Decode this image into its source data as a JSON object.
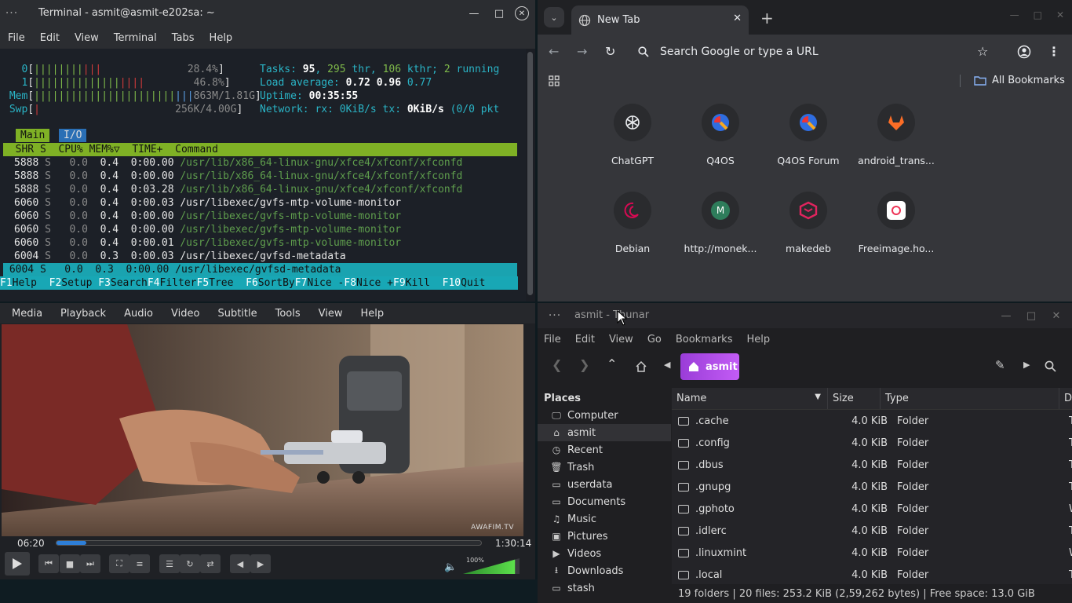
{
  "terminal": {
    "title": "Terminal - asmit@asmit-e202sa: ~",
    "menu": [
      "File",
      "Edit",
      "View",
      "Terminal",
      "Tabs",
      "Help"
    ],
    "cpu0": {
      "bars": "||||||||",
      "pct": "28.4%"
    },
    "cpu1": {
      "bars": "||||||||||||||",
      "pct": "46.8%"
    },
    "mem": {
      "bars": "|||||||||||||||||||||||",
      "value": "863M/1.81G"
    },
    "swp": {
      "value": "256K/4.00G"
    },
    "tasks": {
      "label": "Tasks: ",
      "tasks": "95",
      "thr": "295",
      "kthr": "106",
      "running": "2"
    },
    "load": {
      "label": "Load average: ",
      "a": "0.72",
      "b": "0.96",
      "c": "0.77"
    },
    "uptime": {
      "label": "Uptime: ",
      "value": "00:35:55"
    },
    "network": {
      "label": "Network: rx: ",
      "rx": "0KiB/s",
      "tx": "0KiB/s",
      "tail": "(0/0 pkt"
    },
    "tabs": [
      "Main",
      "I/O"
    ],
    "header": "  SHR S  CPU% MEM%▽  TIME+  Command",
    "rows": [
      {
        "shr": "5888",
        "s": "S",
        "cpu": "0.0",
        "mem": "0.4",
        "time": "0:00.00",
        "cmd": "/usr/lib/x86_64-linux-gnu/xfce4/xfconf/xfconfd",
        "dim": true
      },
      {
        "shr": "5888",
        "s": "S",
        "cpu": "0.0",
        "mem": "0.4",
        "time": "0:00.00",
        "cmd": "/usr/lib/x86_64-linux-gnu/xfce4/xfconf/xfconfd",
        "dim": true
      },
      {
        "shr": "5888",
        "s": "S",
        "cpu": "0.0",
        "mem": "0.4",
        "time": "0:03.28",
        "cmd": "/usr/lib/x86_64-linux-gnu/xfce4/xfconf/xfconfd",
        "dim": true
      },
      {
        "shr": "6060",
        "s": "S",
        "cpu": "0.0",
        "mem": "0.4",
        "time": "0:00.03",
        "cmd": "/usr/libexec/gvfs-mtp-volume-monitor",
        "dim": false
      },
      {
        "shr": "6060",
        "s": "S",
        "cpu": "0.0",
        "mem": "0.4",
        "time": "0:00.00",
        "cmd": "/usr/libexec/gvfs-mtp-volume-monitor",
        "dim": true
      },
      {
        "shr": "6060",
        "s": "S",
        "cpu": "0.0",
        "mem": "0.4",
        "time": "0:00.00",
        "cmd": "/usr/libexec/gvfs-mtp-volume-monitor",
        "dim": true
      },
      {
        "shr": "6060",
        "s": "S",
        "cpu": "0.0",
        "mem": "0.4",
        "time": "0:00.01",
        "cmd": "/usr/libexec/gvfs-mtp-volume-monitor",
        "dim": true
      },
      {
        "shr": "6004",
        "s": "S",
        "cpu": "0.0",
        "mem": "0.3",
        "time": "0:00.03",
        "cmd": "/usr/libexec/gvfsd-metadata",
        "dim": false
      }
    ],
    "selected_row": " 6004 S   0.0  0.3  0:00.00 /usr/libexec/gvfsd-metadata",
    "fkeys": [
      {
        "k": "F1",
        "l": "Help  "
      },
      {
        "k": "F2",
        "l": "Setup "
      },
      {
        "k": "F3",
        "l": "Search"
      },
      {
        "k": "F4",
        "l": "Filter"
      },
      {
        "k": "F5",
        "l": "Tree  "
      },
      {
        "k": "F6",
        "l": "SortBy"
      },
      {
        "k": "F7",
        "l": "Nice -"
      },
      {
        "k": "F8",
        "l": "Nice +"
      },
      {
        "k": "F9",
        "l": "Kill  "
      },
      {
        "k": "F10",
        "l": "Quit  "
      }
    ]
  },
  "chrome": {
    "tab_title": "New Tab",
    "omnibox_placeholder": "Search Google or type a URL",
    "all_bookmarks": "All Bookmarks",
    "shortcuts": [
      {
        "label": "ChatGPT",
        "icon": "chatgpt-icon",
        "color": "#e8eaed"
      },
      {
        "label": "Q4OS",
        "icon": "q4os-icon",
        "color": "#2f6de0"
      },
      {
        "label": "Q4OS Forum",
        "icon": "q4os-icon",
        "color": "#2f6de0"
      },
      {
        "label": "android_trans...",
        "icon": "gitlab-icon",
        "color": "#fc6d26"
      },
      {
        "label": "Debian",
        "icon": "debian-icon",
        "color": "#d70a53"
      },
      {
        "label": "http://monek...",
        "icon": "letter-m-icon",
        "color": "#2e7d5b"
      },
      {
        "label": "makedeb",
        "icon": "makedeb-icon",
        "color": "#e0245e"
      },
      {
        "label": "Freeimage.ho...",
        "icon": "freeimage-icon",
        "color": "#ffffff"
      }
    ]
  },
  "vlc": {
    "menu": [
      "Media",
      "Playback",
      "Audio",
      "Video",
      "Subtitle",
      "Tools",
      "View",
      "Help"
    ],
    "elapsed": "06:20",
    "total": "1:30:14",
    "progress": 0.07,
    "volume_label": "100%",
    "volume": 1.0,
    "watermark": "AWAFIM.TV"
  },
  "thunar": {
    "title": "asmit - Thunar",
    "menu": [
      "File",
      "Edit",
      "View",
      "Go",
      "Bookmarks",
      "Help"
    ],
    "crumb": "asmit",
    "places_header": "Places",
    "places": [
      {
        "label": "Computer",
        "icon": "computer-icon"
      },
      {
        "label": "asmit",
        "icon": "home-icon",
        "active": true
      },
      {
        "label": "Recent",
        "icon": "recent-icon"
      },
      {
        "label": "Trash",
        "icon": "trash-icon"
      },
      {
        "label": "userdata",
        "icon": "drive-icon"
      },
      {
        "label": "Documents",
        "icon": "folder-icon"
      },
      {
        "label": "Music",
        "icon": "music-icon"
      },
      {
        "label": "Pictures",
        "icon": "pictures-icon"
      },
      {
        "label": "Videos",
        "icon": "videos-icon"
      },
      {
        "label": "Downloads",
        "icon": "downloads-icon"
      },
      {
        "label": "stash",
        "icon": "drive-icon"
      }
    ],
    "columns": [
      "Name",
      "Size",
      "Type",
      "D"
    ],
    "files": [
      {
        "name": ".cache",
        "size": "4.0 KiB",
        "type": "Folder",
        "d": "T"
      },
      {
        "name": ".config",
        "size": "4.0 KiB",
        "type": "Folder",
        "d": "T"
      },
      {
        "name": ".dbus",
        "size": "4.0 KiB",
        "type": "Folder",
        "d": "T"
      },
      {
        "name": ".gnupg",
        "size": "4.0 KiB",
        "type": "Folder",
        "d": "T"
      },
      {
        "name": ".gphoto",
        "size": "4.0 KiB",
        "type": "Folder",
        "d": "W"
      },
      {
        "name": ".idlerc",
        "size": "4.0 KiB",
        "type": "Folder",
        "d": "T"
      },
      {
        "name": ".linuxmint",
        "size": "4.0 KiB",
        "type": "Folder",
        "d": "W"
      },
      {
        "name": ".local",
        "size": "4.0 KiB",
        "type": "Folder",
        "d": "T"
      }
    ],
    "status": "19 folders  |  20 files: 253.2 KiB (2,59,262 bytes)  |  Free space: 13.0 GiB"
  }
}
